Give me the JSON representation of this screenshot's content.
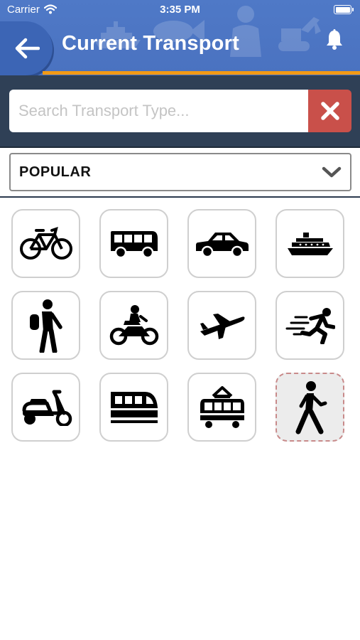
{
  "status_bar": {
    "carrier": "Carrier",
    "time": "3:35 PM"
  },
  "header": {
    "title": "Current Transport"
  },
  "search": {
    "placeholder": "Search Transport Type...",
    "value": ""
  },
  "filter": {
    "selected": "POPULAR"
  },
  "colors": {
    "header_blue": "#4f79c7",
    "accent_orange": "#f29a16",
    "search_band": "#2f4056",
    "clear_red": "#c9504a",
    "tile_border": "#cfcfcf"
  },
  "transport_options": [
    {
      "icon": "bicycle-icon",
      "selected": false
    },
    {
      "icon": "bus-icon",
      "selected": false
    },
    {
      "icon": "car-icon",
      "selected": false
    },
    {
      "icon": "ship-icon",
      "selected": false
    },
    {
      "icon": "hiker-icon",
      "selected": false
    },
    {
      "icon": "motorcycle-icon",
      "selected": false
    },
    {
      "icon": "airplane-icon",
      "selected": false
    },
    {
      "icon": "runner-icon",
      "selected": false
    },
    {
      "icon": "scooter-icon",
      "selected": false
    },
    {
      "icon": "train-icon",
      "selected": false
    },
    {
      "icon": "tram-icon",
      "selected": false
    },
    {
      "icon": "walking-icon",
      "selected": true
    }
  ]
}
